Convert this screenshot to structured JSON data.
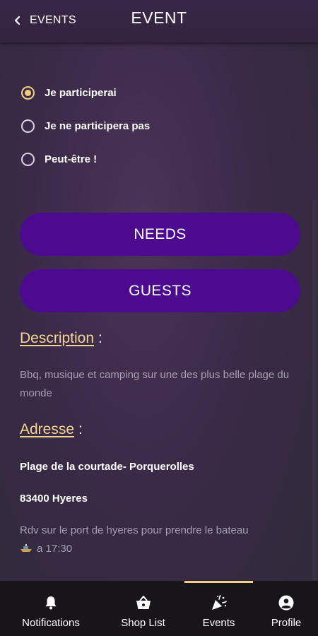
{
  "header": {
    "back_label": "EVENTS",
    "title": "EVENT"
  },
  "rsvp": {
    "options": [
      {
        "label": "Je participerai",
        "selected": true
      },
      {
        "label": "Je ne participera pas",
        "selected": false
      },
      {
        "label": "Peut-être !",
        "selected": false
      }
    ]
  },
  "buttons": {
    "needs": "NEEDS",
    "guests": "GUESTS"
  },
  "description": {
    "heading": "Description",
    "colon": ":",
    "text": "Bbq, musique et camping sur une des plus belle plage du monde"
  },
  "address": {
    "heading": "Adresse",
    "colon": ":",
    "line1": "Plage de la courtade- Porquerolles",
    "line2": "83400 Hyeres",
    "note_before": "Rdv sur le port de hyeres pour prendre le bateau",
    "note_after": "a 17:30"
  },
  "tabbar": {
    "tabs": [
      {
        "label": "Notifications",
        "icon": "bell-icon",
        "active": false
      },
      {
        "label": "Shop List",
        "icon": "basket-icon",
        "active": false
      },
      {
        "label": "Events",
        "icon": "party-popper-icon",
        "active": true
      },
      {
        "label": "Profile",
        "icon": "user-circle-icon",
        "active": false
      }
    ]
  },
  "colors": {
    "accent": "#f2cf7d",
    "button": "#4c0a8e",
    "tabbar": "#17151a",
    "muted_text": "#a79eb0"
  }
}
